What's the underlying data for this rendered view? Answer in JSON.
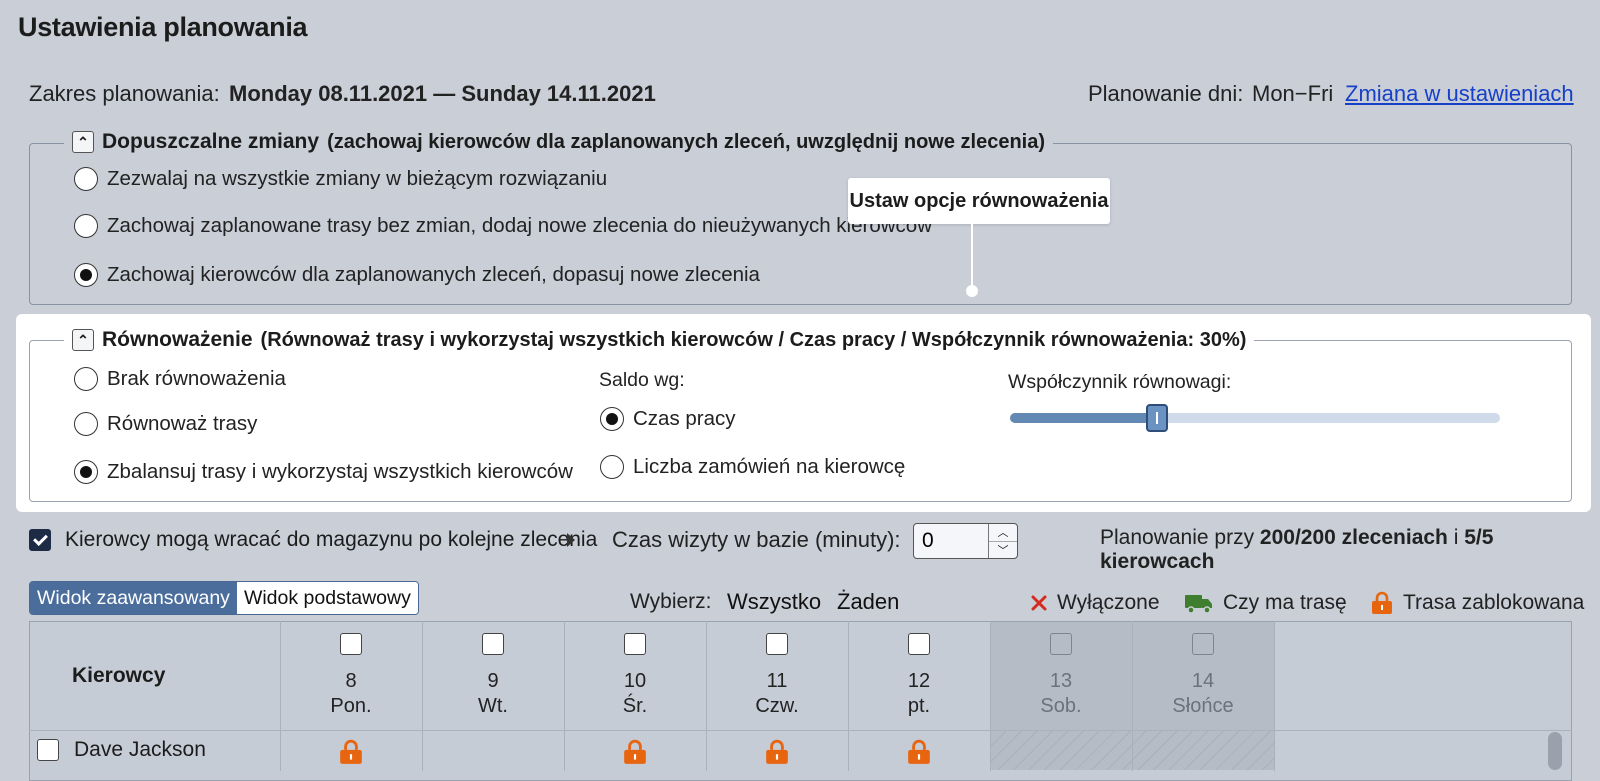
{
  "page_title": "Ustawienia planowania",
  "range": {
    "label": "Zakres planowania:",
    "value": "Monday 08.11.2021 — Sunday 14.11.2021"
  },
  "planning_days": {
    "label": "Planowanie dni:",
    "value": "Mon−Fri",
    "change_link": "Zmiana w ustawieniach"
  },
  "changes": {
    "title": "Dopuszczalne zmiany",
    "subtitle": "(zachowaj kierowców dla zaplanowanych zleceń, uwzględnij nowe zlecenia)",
    "options": [
      {
        "label": "Zezwalaj na wszystkie zmiany w bieżącym rozwiązaniu",
        "selected": false
      },
      {
        "label": "Zachowaj zaplanowane trasy bez zmian, dodaj nowe zlecenia do nieużywanych kierowców",
        "selected": false
      },
      {
        "label": "Zachowaj kierowców dla zaplanowanych zleceń, dopasuj nowe zlecenia",
        "selected": true
      }
    ]
  },
  "tooltip": {
    "text": "Ustaw opcje równoważenia"
  },
  "balance": {
    "title": "Równoważenie",
    "subtitle": "(Równoważ trasy i wykorzystaj wszystkich kierowców / Czas pracy / Współczynnik równoważenia: 30%)",
    "options": [
      {
        "label": "Brak równoważenia",
        "selected": false
      },
      {
        "label": "Równoważ trasy",
        "selected": false
      },
      {
        "label": "Zbalansuj trasy i wykorzystaj wszystkich kierowców",
        "selected": true
      }
    ],
    "by_label": "Saldo wg:",
    "by_options": [
      {
        "label": "Czas pracy",
        "selected": true
      },
      {
        "label": "Liczba zamówień na kierowcę",
        "selected": false
      }
    ],
    "factor_label": "Współczynnik równowagi:",
    "factor_value": 0.3
  },
  "return_option": {
    "label": "Kierowcy mogą wracać do magazynu po kolejne zlecenia",
    "checked": true
  },
  "visit_time": {
    "label": "Czas wizyty w bazie (minuty):",
    "value": "0"
  },
  "plan_summary": {
    "prefix": "Planowanie przy ",
    "orders": "200/200 zleceniach",
    "middle": " i ",
    "drivers": "5/5 kierowcach"
  },
  "views": {
    "advanced": "Widok zaawansowany",
    "basic": "Widok podstawowy"
  },
  "select": {
    "label": "Wybierz:",
    "all": "Wszystko",
    "none": "Żaden"
  },
  "legend": {
    "disabled": "Wyłączone",
    "has_route": "Czy ma trasę",
    "locked": "Trasa zablokowana"
  },
  "colors": {
    "disabled": "#d52b1e",
    "has_route": "#3f7d2f",
    "locked": "#e8650f",
    "accent": "#4a6d9c"
  },
  "grid": {
    "drivers_header": "Kierowcy",
    "days": [
      {
        "num": "8",
        "name": "Pon."
      },
      {
        "num": "9",
        "name": "Wt."
      },
      {
        "num": "10",
        "name": "Śr."
      },
      {
        "num": "11",
        "name": "Czw."
      },
      {
        "num": "12",
        "name": "pt."
      },
      {
        "num": "13",
        "name": "Sob."
      },
      {
        "num": "14",
        "name": "Słońce"
      }
    ],
    "rows": [
      {
        "name": "Dave Jackson",
        "locked_days": [
          0,
          2,
          3,
          4
        ]
      }
    ]
  }
}
